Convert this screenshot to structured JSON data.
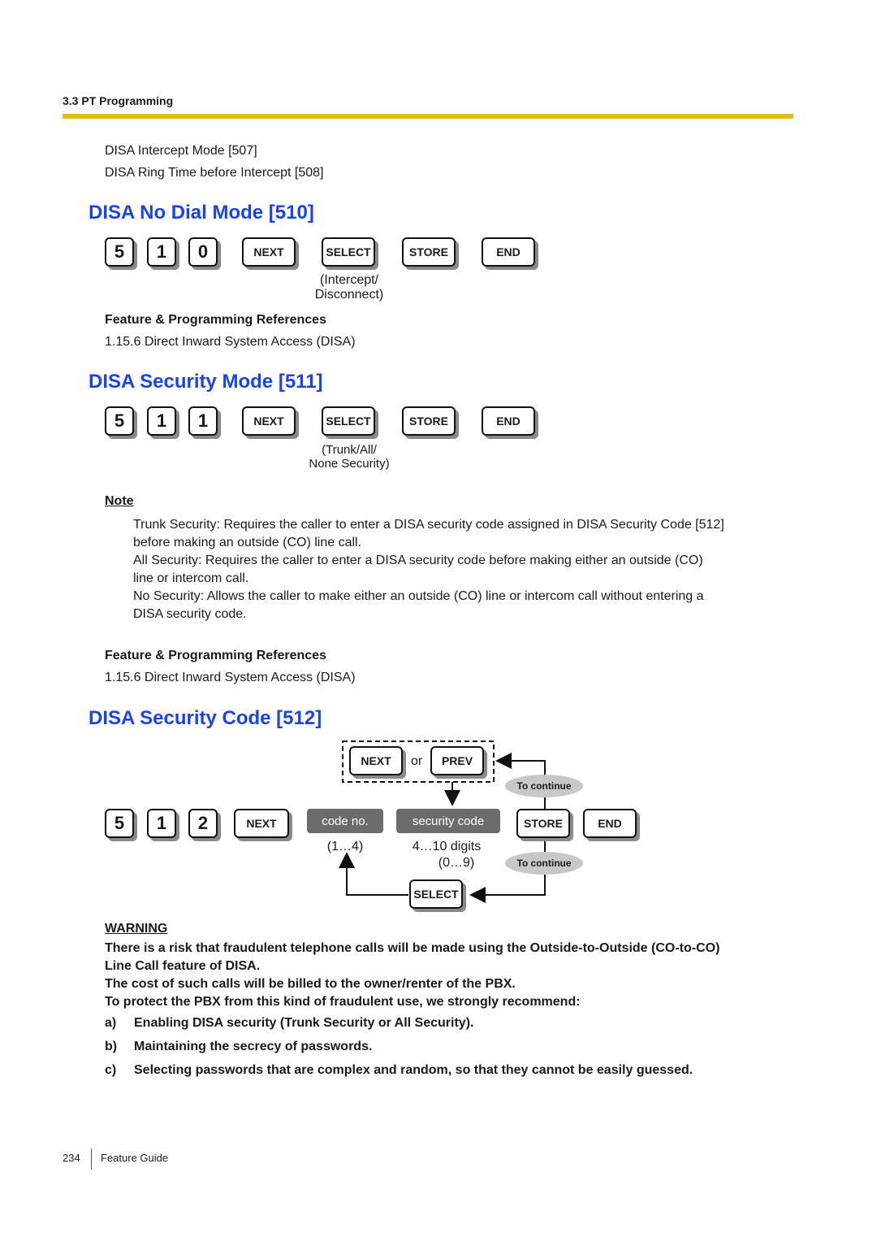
{
  "header": {
    "section": "3.3 PT Programming"
  },
  "intro_refs": [
    "DISA Intercept Mode [507]",
    "DISA Ring Time before Intercept [508]"
  ],
  "sections": [
    {
      "title": "DISA No Dial Mode [510]",
      "keys": [
        "5",
        "1",
        "0"
      ],
      "buttons": [
        "NEXT",
        "SELECT",
        "STORE",
        "END"
      ],
      "select_caption": [
        "(Intercept/",
        "Disconnect)"
      ],
      "refs_title": "Feature & Programming References",
      "refs": [
        "1.15.6 Direct Inward System Access (DISA)"
      ]
    },
    {
      "title": "DISA Security Mode [511]",
      "keys": [
        "5",
        "1",
        "1"
      ],
      "buttons": [
        "NEXT",
        "SELECT",
        "STORE",
        "END"
      ],
      "select_caption": [
        "(Trunk/All/",
        "None Security)"
      ],
      "note_label": "Note",
      "notes": [
        [
          "Trunk Security: Requires the caller to enter a DISA security code assigned in DISA Security Code [512]",
          "before making an outside (CO) line call."
        ],
        [
          "All Security: Requires the caller to enter a DISA security code before making either an outside (CO)",
          "line or intercom call."
        ],
        [
          "No Security: Allows the caller to make either an outside (CO) line or intercom call without entering a",
          "DISA security code."
        ]
      ],
      "refs_title": "Feature & Programming References",
      "refs": [
        "1.15.6 Direct Inward System Access (DISA)"
      ]
    },
    {
      "title": "DISA Security Code [512]",
      "keys": [
        "5",
        "1",
        "2"
      ],
      "next": "NEXT",
      "or_text": "or",
      "prev": "PREV",
      "code_no": "code no.",
      "code_no_range": "(1…4)",
      "security_code": "security code",
      "security_digits": "4…10 digits",
      "security_range": "(0…9)",
      "store": "STORE",
      "end": "END",
      "select": "SELECT",
      "to_continue": "To continue"
    }
  ],
  "warning": {
    "label": "WARNING",
    "lines": [
      "There is a risk that fraudulent telephone calls will be made using the Outside-to-Outside (CO-to-CO)",
      "Line Call feature of DISA.",
      "The cost of such calls will be billed to the owner/renter of the PBX.",
      "To protect the PBX from this kind of fraudulent use, we strongly recommend:"
    ],
    "items": [
      {
        "marker": "a)",
        "text": "Enabling DISA security (Trunk Security or All Security)."
      },
      {
        "marker": "b)",
        "text": "Maintaining the secrecy of passwords."
      },
      {
        "marker": "c)",
        "text": "Selecting passwords that are complex and random, so that they cannot be easily guessed."
      }
    ]
  },
  "footer": {
    "page": "234",
    "title": "Feature Guide"
  },
  "colors": {
    "heading": "#1a44e8",
    "rule": "#e2bd10"
  }
}
